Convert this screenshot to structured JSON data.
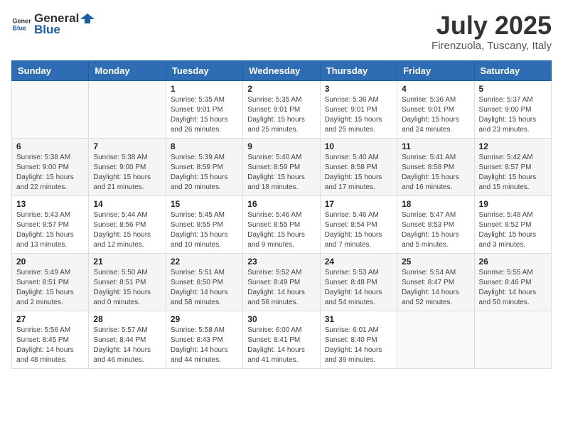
{
  "logo": {
    "general": "General",
    "blue": "Blue"
  },
  "title": {
    "month_year": "July 2025",
    "location": "Firenzuola, Tuscany, Italy"
  },
  "headers": [
    "Sunday",
    "Monday",
    "Tuesday",
    "Wednesday",
    "Thursday",
    "Friday",
    "Saturday"
  ],
  "weeks": [
    [
      {
        "day": "",
        "sunrise": "",
        "sunset": "",
        "daylight": ""
      },
      {
        "day": "",
        "sunrise": "",
        "sunset": "",
        "daylight": ""
      },
      {
        "day": "1",
        "sunrise": "Sunrise: 5:35 AM",
        "sunset": "Sunset: 9:01 PM",
        "daylight": "Daylight: 15 hours and 26 minutes."
      },
      {
        "day": "2",
        "sunrise": "Sunrise: 5:35 AM",
        "sunset": "Sunset: 9:01 PM",
        "daylight": "Daylight: 15 hours and 25 minutes."
      },
      {
        "day": "3",
        "sunrise": "Sunrise: 5:36 AM",
        "sunset": "Sunset: 9:01 PM",
        "daylight": "Daylight: 15 hours and 25 minutes."
      },
      {
        "day": "4",
        "sunrise": "Sunrise: 5:36 AM",
        "sunset": "Sunset: 9:01 PM",
        "daylight": "Daylight: 15 hours and 24 minutes."
      },
      {
        "day": "5",
        "sunrise": "Sunrise: 5:37 AM",
        "sunset": "Sunset: 9:00 PM",
        "daylight": "Daylight: 15 hours and 23 minutes."
      }
    ],
    [
      {
        "day": "6",
        "sunrise": "Sunrise: 5:38 AM",
        "sunset": "Sunset: 9:00 PM",
        "daylight": "Daylight: 15 hours and 22 minutes."
      },
      {
        "day": "7",
        "sunrise": "Sunrise: 5:38 AM",
        "sunset": "Sunset: 9:00 PM",
        "daylight": "Daylight: 15 hours and 21 minutes."
      },
      {
        "day": "8",
        "sunrise": "Sunrise: 5:39 AM",
        "sunset": "Sunset: 8:59 PM",
        "daylight": "Daylight: 15 hours and 20 minutes."
      },
      {
        "day": "9",
        "sunrise": "Sunrise: 5:40 AM",
        "sunset": "Sunset: 8:59 PM",
        "daylight": "Daylight: 15 hours and 18 minutes."
      },
      {
        "day": "10",
        "sunrise": "Sunrise: 5:40 AM",
        "sunset": "Sunset: 8:58 PM",
        "daylight": "Daylight: 15 hours and 17 minutes."
      },
      {
        "day": "11",
        "sunrise": "Sunrise: 5:41 AM",
        "sunset": "Sunset: 8:58 PM",
        "daylight": "Daylight: 15 hours and 16 minutes."
      },
      {
        "day": "12",
        "sunrise": "Sunrise: 5:42 AM",
        "sunset": "Sunset: 8:57 PM",
        "daylight": "Daylight: 15 hours and 15 minutes."
      }
    ],
    [
      {
        "day": "13",
        "sunrise": "Sunrise: 5:43 AM",
        "sunset": "Sunset: 8:57 PM",
        "daylight": "Daylight: 15 hours and 13 minutes."
      },
      {
        "day": "14",
        "sunrise": "Sunrise: 5:44 AM",
        "sunset": "Sunset: 8:56 PM",
        "daylight": "Daylight: 15 hours and 12 minutes."
      },
      {
        "day": "15",
        "sunrise": "Sunrise: 5:45 AM",
        "sunset": "Sunset: 8:55 PM",
        "daylight": "Daylight: 15 hours and 10 minutes."
      },
      {
        "day": "16",
        "sunrise": "Sunrise: 5:46 AM",
        "sunset": "Sunset: 8:55 PM",
        "daylight": "Daylight: 15 hours and 9 minutes."
      },
      {
        "day": "17",
        "sunrise": "Sunrise: 5:46 AM",
        "sunset": "Sunset: 8:54 PM",
        "daylight": "Daylight: 15 hours and 7 minutes."
      },
      {
        "day": "18",
        "sunrise": "Sunrise: 5:47 AM",
        "sunset": "Sunset: 8:53 PM",
        "daylight": "Daylight: 15 hours and 5 minutes."
      },
      {
        "day": "19",
        "sunrise": "Sunrise: 5:48 AM",
        "sunset": "Sunset: 8:52 PM",
        "daylight": "Daylight: 15 hours and 3 minutes."
      }
    ],
    [
      {
        "day": "20",
        "sunrise": "Sunrise: 5:49 AM",
        "sunset": "Sunset: 8:51 PM",
        "daylight": "Daylight: 15 hours and 2 minutes."
      },
      {
        "day": "21",
        "sunrise": "Sunrise: 5:50 AM",
        "sunset": "Sunset: 8:51 PM",
        "daylight": "Daylight: 15 hours and 0 minutes."
      },
      {
        "day": "22",
        "sunrise": "Sunrise: 5:51 AM",
        "sunset": "Sunset: 8:50 PM",
        "daylight": "Daylight: 14 hours and 58 minutes."
      },
      {
        "day": "23",
        "sunrise": "Sunrise: 5:52 AM",
        "sunset": "Sunset: 8:49 PM",
        "daylight": "Daylight: 14 hours and 56 minutes."
      },
      {
        "day": "24",
        "sunrise": "Sunrise: 5:53 AM",
        "sunset": "Sunset: 8:48 PM",
        "daylight": "Daylight: 14 hours and 54 minutes."
      },
      {
        "day": "25",
        "sunrise": "Sunrise: 5:54 AM",
        "sunset": "Sunset: 8:47 PM",
        "daylight": "Daylight: 14 hours and 52 minutes."
      },
      {
        "day": "26",
        "sunrise": "Sunrise: 5:55 AM",
        "sunset": "Sunset: 8:46 PM",
        "daylight": "Daylight: 14 hours and 50 minutes."
      }
    ],
    [
      {
        "day": "27",
        "sunrise": "Sunrise: 5:56 AM",
        "sunset": "Sunset: 8:45 PM",
        "daylight": "Daylight: 14 hours and 48 minutes."
      },
      {
        "day": "28",
        "sunrise": "Sunrise: 5:57 AM",
        "sunset": "Sunset: 8:44 PM",
        "daylight": "Daylight: 14 hours and 46 minutes."
      },
      {
        "day": "29",
        "sunrise": "Sunrise: 5:58 AM",
        "sunset": "Sunset: 8:43 PM",
        "daylight": "Daylight: 14 hours and 44 minutes."
      },
      {
        "day": "30",
        "sunrise": "Sunrise: 6:00 AM",
        "sunset": "Sunset: 8:41 PM",
        "daylight": "Daylight: 14 hours and 41 minutes."
      },
      {
        "day": "31",
        "sunrise": "Sunrise: 6:01 AM",
        "sunset": "Sunset: 8:40 PM",
        "daylight": "Daylight: 14 hours and 39 minutes."
      },
      {
        "day": "",
        "sunrise": "",
        "sunset": "",
        "daylight": ""
      },
      {
        "day": "",
        "sunrise": "",
        "sunset": "",
        "daylight": ""
      }
    ]
  ]
}
